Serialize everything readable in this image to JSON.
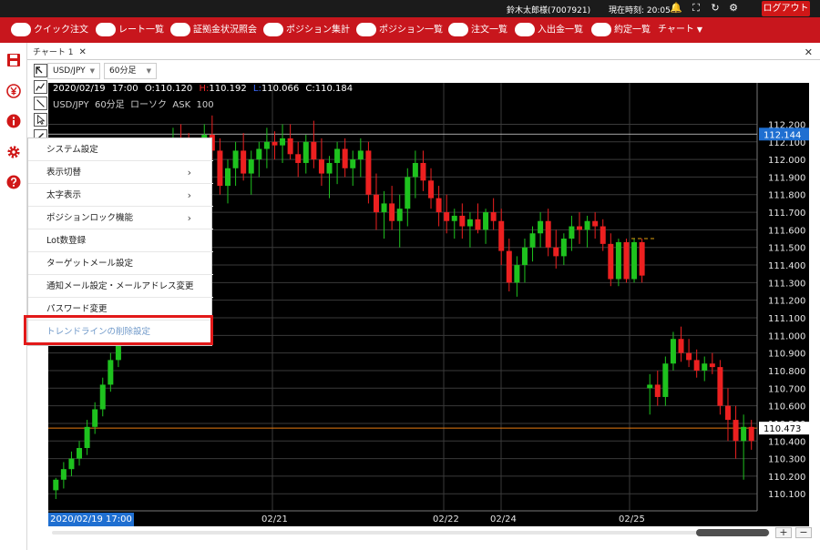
{
  "header": {
    "user": "鈴木太郎様(7007921)",
    "clock": "現在時刻: 20:05",
    "logout_label": "ログアウト"
  },
  "menu": {
    "items": [
      {
        "label": "クイック注文"
      },
      {
        "label": "レート一覧"
      },
      {
        "label": "証拠金状況照会"
      },
      {
        "label": "ポジション集計"
      },
      {
        "label": "ポジション一覧"
      },
      {
        "label": "注文一覧"
      },
      {
        "label": "入出金一覧"
      },
      {
        "label": "約定一覧"
      }
    ],
    "chart_label": "チャート"
  },
  "tab": {
    "label": "チャート 1"
  },
  "toolbar": {
    "symbol": "USD/JPY",
    "interval": "60分足"
  },
  "chart": {
    "ohlc": {
      "date": "2020/02/19",
      "time": "17:00",
      "open": "O:110.120",
      "high_prefix": "H:",
      "high": "110.192",
      "low_prefix": "L:",
      "low": "110.066",
      "close": "C:110.184"
    },
    "subtitle": "USD/JPY  60分足  ローソク  ASK  100",
    "price_ticks": [
      "112.200",
      "112.100",
      "112.000",
      "111.900",
      "111.800",
      "111.700",
      "111.600",
      "111.500",
      "111.400",
      "111.300",
      "111.200",
      "111.100",
      "111.000",
      "110.900",
      "110.800",
      "110.700",
      "110.600",
      "110.500",
      "110.400",
      "110.300",
      "110.200",
      "110.100"
    ],
    "price_min": 110.065,
    "price_max": 112.28,
    "date_ticks": [
      "02/21",
      "02/22",
      "02/24",
      "02/25"
    ],
    "current_price_label": "112.144",
    "level_line_label": "110.473",
    "cursor_label": "2020/02/19 17:00",
    "colors": {
      "up": "#1ec21e",
      "down": "#ec2020",
      "highlight_label": "#1f6fd1",
      "level_line": "#e87b10"
    }
  },
  "context_menu": {
    "items": [
      {
        "label": "システム設定",
        "submenu": false
      },
      {
        "label": "表示切替",
        "submenu": true
      },
      {
        "label": "太字表示",
        "submenu": true
      },
      {
        "label": "ポジションロック機能",
        "submenu": true
      },
      {
        "label": "Lot数登録",
        "submenu": false
      },
      {
        "label": "ターゲットメール設定",
        "submenu": false
      },
      {
        "label": "通知メール設定・メールアドレス変更",
        "submenu": false
      },
      {
        "label": "パスワード変更",
        "submenu": false
      },
      {
        "label": "トレンドラインの削除設定",
        "submenu": false
      }
    ],
    "arrow": "›"
  },
  "scroll": {
    "zoom_in": "+",
    "zoom_out": "−"
  },
  "chart_data": {
    "type": "candlestick",
    "symbol": "USD/JPY",
    "interval": "60分足",
    "y_axis_ticks": [
      112.2,
      112.1,
      112.0,
      111.9,
      111.8,
      111.7,
      111.6,
      111.5,
      111.4,
      111.3,
      111.2,
      111.1,
      111.0,
      110.9,
      110.8,
      110.7,
      110.6,
      110.5,
      110.4,
      110.3,
      110.2,
      110.1
    ],
    "x_axis_ticks": [
      "02/21",
      "02/22",
      "02/24",
      "02/25"
    ],
    "current_price": 112.144,
    "level_line": 110.473,
    "ohlc_readout": {
      "date": "2020/02/19 17:00",
      "open": 110.12,
      "high": 110.192,
      "low": 110.066,
      "close": 110.184
    },
    "candles": [
      [
        110.12,
        110.19,
        110.07,
        110.18
      ],
      [
        110.18,
        110.28,
        110.13,
        110.24
      ],
      [
        110.24,
        110.34,
        110.2,
        110.3
      ],
      [
        110.3,
        110.4,
        110.26,
        110.36
      ],
      [
        110.36,
        110.52,
        110.32,
        110.48
      ],
      [
        110.48,
        110.62,
        110.44,
        110.58
      ],
      [
        110.58,
        110.76,
        110.54,
        110.72
      ],
      [
        110.72,
        110.9,
        110.68,
        110.86
      ],
      [
        110.86,
        111.1,
        110.82,
        111.06
      ],
      [
        111.06,
        111.32,
        111.02,
        111.28
      ],
      [
        111.28,
        111.55,
        111.22,
        111.5
      ],
      [
        111.5,
        111.75,
        111.45,
        111.7
      ],
      [
        111.7,
        111.9,
        111.6,
        111.85
      ],
      [
        111.85,
        112.0,
        111.78,
        111.95
      ],
      [
        111.95,
        112.1,
        111.9,
        112.05
      ],
      [
        112.05,
        112.18,
        111.95,
        112.1
      ],
      [
        112.1,
        112.2,
        111.98,
        112.0
      ],
      [
        112.0,
        112.15,
        111.85,
        111.88
      ],
      [
        111.88,
        112.0,
        111.7,
        111.98
      ],
      [
        111.98,
        112.2,
        111.85,
        112.14
      ],
      [
        112.14,
        112.25,
        112.0,
        112.05
      ],
      [
        112.05,
        112.12,
        111.8,
        111.85
      ],
      [
        111.85,
        112.0,
        111.75,
        111.95
      ],
      [
        111.95,
        112.1,
        111.85,
        112.05
      ],
      [
        112.05,
        112.15,
        111.88,
        111.92
      ],
      [
        111.92,
        112.05,
        111.8,
        112.0
      ],
      [
        112.0,
        112.1,
        111.9,
        112.06
      ],
      [
        112.06,
        112.18,
        111.95,
        112.1
      ],
      [
        112.1,
        112.16,
        112.0,
        112.08
      ],
      [
        112.08,
        112.2,
        111.98,
        112.12
      ],
      [
        112.12,
        112.2,
        112.0,
        112.03
      ],
      [
        112.03,
        112.1,
        111.9,
        111.98
      ],
      [
        111.98,
        112.14,
        111.92,
        112.1
      ],
      [
        112.1,
        112.22,
        111.95,
        112.0
      ],
      [
        112.0,
        112.12,
        111.85,
        111.92
      ],
      [
        111.92,
        112.02,
        111.78,
        111.98
      ],
      [
        111.98,
        112.1,
        111.86,
        112.06
      ],
      [
        112.06,
        112.12,
        111.9,
        111.95
      ],
      [
        111.95,
        112.05,
        111.85,
        112.0
      ],
      [
        112.0,
        112.12,
        111.9,
        112.05
      ],
      [
        112.05,
        112.1,
        111.75,
        111.8
      ],
      [
        111.8,
        111.92,
        111.6,
        111.7
      ],
      [
        111.7,
        111.82,
        111.55,
        111.75
      ],
      [
        111.75,
        111.85,
        111.6,
        111.65
      ],
      [
        111.65,
        111.8,
        111.5,
        111.72
      ],
      [
        111.72,
        111.95,
        111.62,
        111.9
      ],
      [
        111.9,
        112.05,
        111.78,
        111.98
      ],
      [
        111.98,
        112.05,
        111.82,
        111.88
      ],
      [
        111.88,
        111.95,
        111.72,
        111.78
      ],
      [
        111.78,
        111.85,
        111.62,
        111.7
      ],
      [
        111.7,
        111.8,
        111.58,
        111.65
      ],
      [
        111.65,
        111.72,
        111.55,
        111.68
      ],
      [
        111.68,
        111.75,
        111.55,
        111.62
      ],
      [
        111.62,
        111.7,
        111.5,
        111.66
      ],
      [
        111.66,
        111.75,
        111.58,
        111.6
      ],
      [
        111.6,
        111.72,
        111.52,
        111.7
      ],
      [
        111.7,
        111.78,
        111.6,
        111.65
      ],
      [
        111.65,
        111.72,
        111.4,
        111.48
      ],
      [
        111.48,
        111.55,
        111.25,
        111.3
      ],
      [
        111.3,
        111.45,
        111.22,
        111.4
      ],
      [
        111.4,
        111.55,
        111.3,
        111.5
      ],
      [
        111.5,
        111.62,
        111.42,
        111.58
      ],
      [
        111.58,
        111.7,
        111.5,
        111.65
      ],
      [
        111.65,
        111.72,
        111.45,
        111.5
      ],
      [
        111.5,
        111.6,
        111.38,
        111.45
      ],
      [
        111.45,
        111.58,
        111.4,
        111.55
      ],
      [
        111.55,
        111.68,
        111.48,
        111.62
      ],
      [
        111.62,
        111.7,
        111.52,
        111.6
      ],
      [
        111.6,
        111.68,
        111.5,
        111.65
      ],
      [
        111.65,
        111.7,
        111.55,
        111.62
      ],
      [
        111.62,
        111.66,
        111.48,
        111.52
      ],
      [
        111.52,
        111.58,
        111.28,
        111.32
      ],
      [
        111.32,
        111.55,
        111.28,
        111.53
      ],
      [
        111.53,
        111.55,
        111.3,
        111.32
      ],
      [
        111.32,
        111.55,
        111.3,
        111.53
      ],
      [
        111.53,
        111.55,
        111.3,
        111.34
      ],
      [
        110.7,
        110.78,
        110.55,
        110.72
      ],
      [
        110.72,
        110.8,
        110.6,
        110.65
      ],
      [
        110.65,
        110.88,
        110.6,
        110.84
      ],
      [
        110.84,
        111.02,
        110.8,
        110.98
      ],
      [
        110.98,
        111.05,
        110.85,
        110.9
      ],
      [
        110.9,
        110.98,
        110.82,
        110.86
      ],
      [
        110.86,
        110.92,
        110.76,
        110.8
      ],
      [
        110.8,
        110.88,
        110.74,
        110.84
      ],
      [
        110.84,
        110.9,
        110.78,
        110.82
      ],
      [
        110.82,
        110.86,
        110.55,
        110.6
      ],
      [
        110.6,
        110.7,
        110.4,
        110.52
      ],
      [
        110.52,
        110.6,
        110.3,
        110.4
      ],
      [
        110.4,
        110.55,
        110.18,
        110.48
      ],
      [
        110.48,
        110.52,
        110.35,
        110.4
      ]
    ]
  }
}
